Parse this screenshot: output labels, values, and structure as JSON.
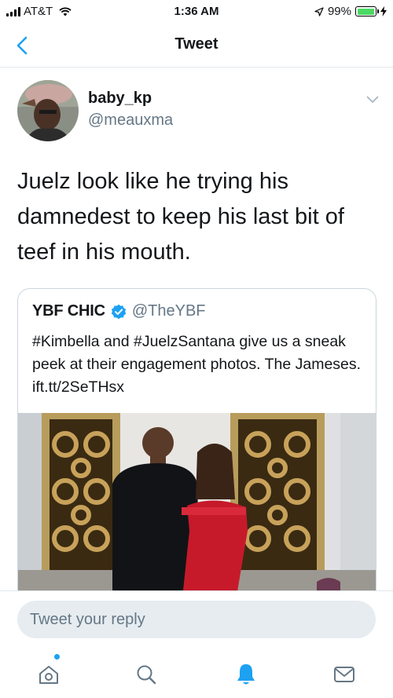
{
  "status_bar": {
    "carrier": "AT&T",
    "time": "1:36 AM",
    "battery_percent": "99%",
    "battery_level": 0.99,
    "battery_color": "#4cd964"
  },
  "nav": {
    "title": "Tweet",
    "back_icon": "chevron-left-icon",
    "accent_color": "#1da1f2"
  },
  "tweet": {
    "display_name": "baby_kp",
    "handle": "@meauxma",
    "text": "Juelz look like he trying his damnedest to keep his last bit of teef in his mouth.",
    "quoted": {
      "display_name": "YBF CHIC",
      "verified": true,
      "handle": "@TheYBF",
      "text": "#Kimbella and #JuelzSantana give us a sneak peek at their engagement photos. The Jameses. ift.tt/2SeTHsx"
    }
  },
  "reply": {
    "placeholder": "Tweet your reply"
  },
  "tabs": [
    {
      "name": "home",
      "icon": "home-icon",
      "active": false,
      "has_dot": true
    },
    {
      "name": "search",
      "icon": "search-icon",
      "active": false
    },
    {
      "name": "notifications",
      "icon": "bell-icon",
      "active": true
    },
    {
      "name": "messages",
      "icon": "mail-icon",
      "active": false
    }
  ]
}
